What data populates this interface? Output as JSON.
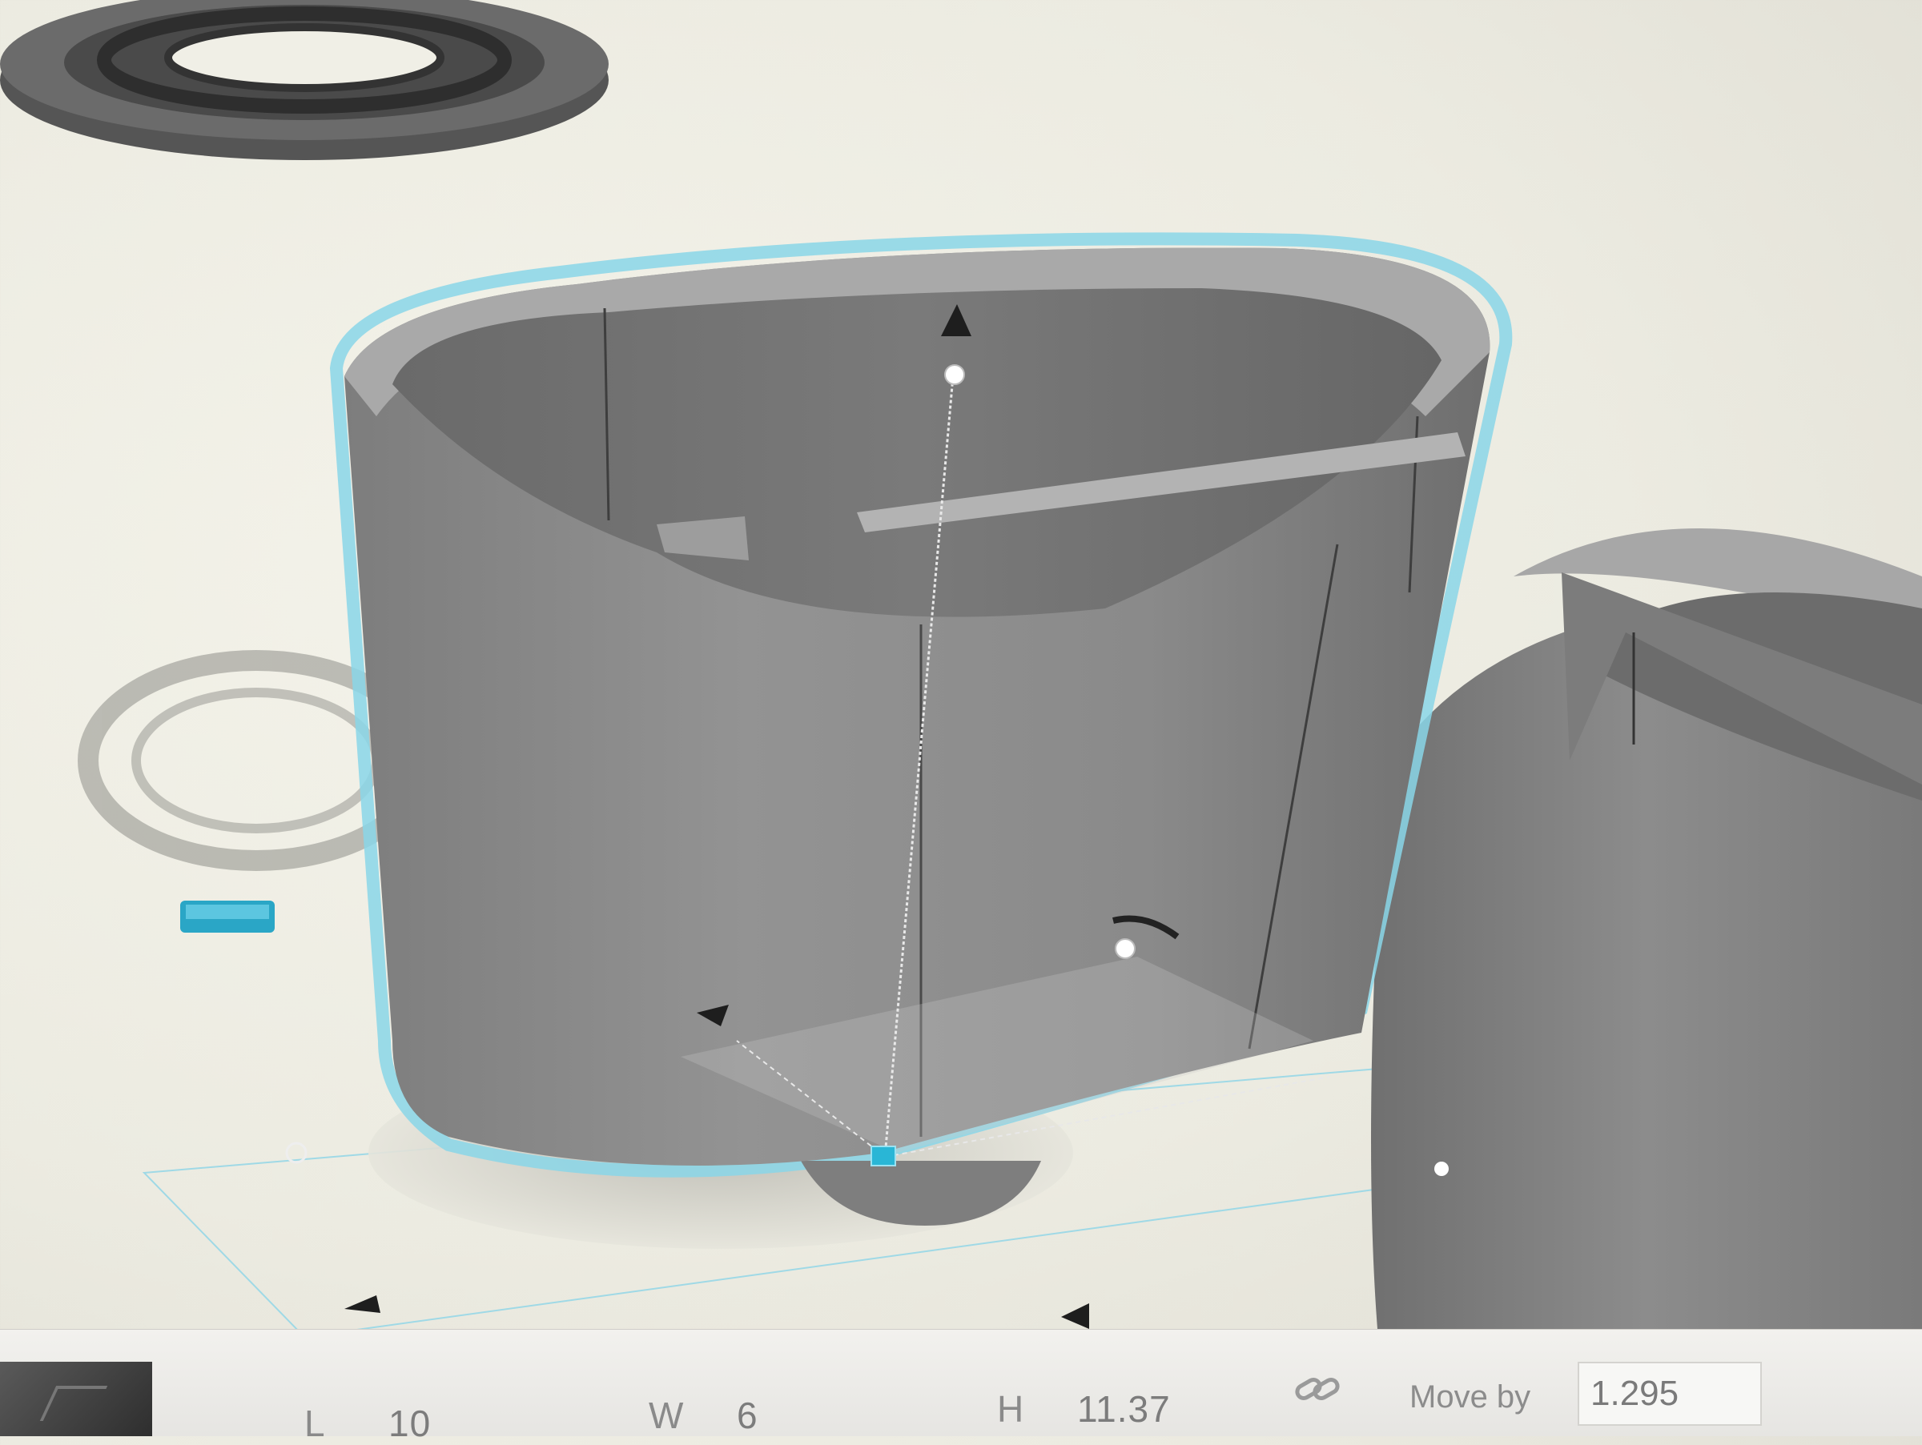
{
  "app": "3D modeling workplane",
  "colors": {
    "selection": "#7fd4e8",
    "handle": "#29b6d6",
    "object": "#8f8f8f",
    "workplane": "#ecebe1"
  },
  "icons": {
    "height_arrow": "up-arrow-icon",
    "rotate_handle": "rotate-arrow-icon",
    "lock_proportions": "link-icon"
  },
  "dimensions": {
    "length_label": "L",
    "length_value": "10",
    "width_label": "W",
    "width_value": "6",
    "height_label": "H",
    "height_value": "11.37"
  },
  "move_by": {
    "label": "Move by",
    "value": "1.295"
  }
}
